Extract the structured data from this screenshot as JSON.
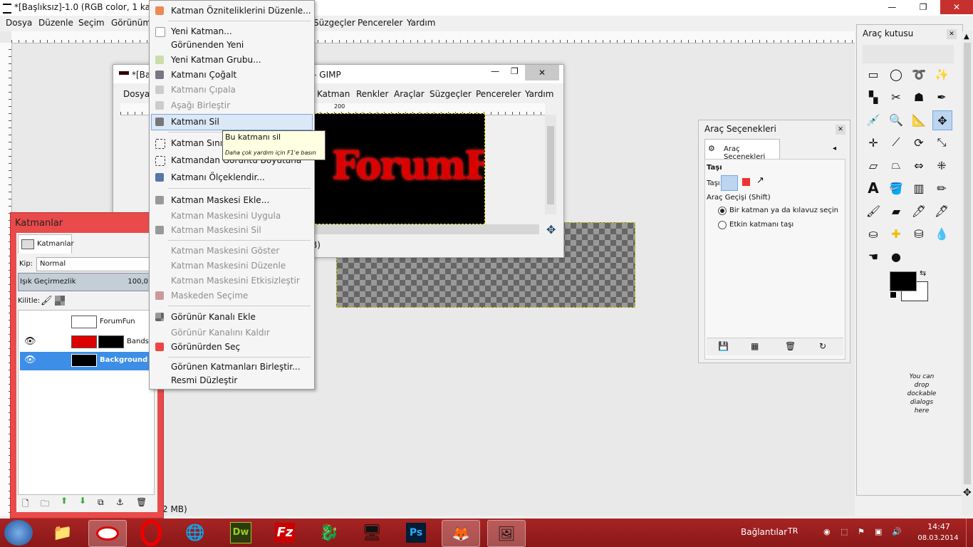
{
  "window": {
    "title": "*[Başlıksız]-1.0 (RGB color, 1 katm",
    "controls": {
      "minimize": "—",
      "maximize": "❐",
      "close": "✕"
    }
  },
  "menubar": [
    "Dosya",
    "Düzenle",
    "Seçim",
    "Görünüm",
    "Süzgeçler",
    "Pencereler",
    "Yardım"
  ],
  "win2": {
    "title_left": "*[Ba",
    "title_right": "5 – GIMP",
    "menu": [
      "Dosya",
      "Katman",
      "Renkler",
      "Araçlar",
      "Süzgeçler",
      "Pencereler",
      "Yardım"
    ],
    "ruler_mark": "200",
    "status": "B)"
  },
  "status_main": "2 MB)",
  "context_menu": {
    "items": [
      {
        "label": "Katman Özniteliklerini Düzenle...",
        "enabled": true
      },
      {
        "label": "Yeni Katman...",
        "enabled": true
      },
      {
        "label": "Görünenden Yeni",
        "enabled": true
      },
      {
        "label": "Yeni Katman Grubu...",
        "enabled": true
      },
      {
        "label": "Katmanı Çoğalt",
        "enabled": true
      },
      {
        "label": "Katmanı Çıpala",
        "enabled": false
      },
      {
        "label": "Aşağı Birleştir",
        "enabled": false
      },
      {
        "label": "Katmanı Sil",
        "enabled": true,
        "highlighted": true
      },
      {
        "label": "Katman Sınır B",
        "enabled": true
      },
      {
        "label": "Katmandan Görüntü Boyutuna",
        "enabled": true
      },
      {
        "label": "Katmanı Ölçeklendir...",
        "enabled": true
      },
      {
        "label": "Katman Maskesi Ekle...",
        "enabled": true
      },
      {
        "label": "Katman Maskesini Uygula",
        "enabled": false
      },
      {
        "label": "Katman Maskesini Sil",
        "enabled": false
      },
      {
        "label": "Katman Maskesini Göster",
        "enabled": false
      },
      {
        "label": "Katman Maskesini Düzenle",
        "enabled": false
      },
      {
        "label": "Katman Maskesini Etkisizleştir",
        "enabled": false
      },
      {
        "label": "Maskeden Seçime",
        "enabled": false
      },
      {
        "label": "Görünür Kanalı Ekle",
        "enabled": true
      },
      {
        "label": "Görünür Kanalını Kaldır",
        "enabled": false
      },
      {
        "label": "Görünürden Seç",
        "enabled": true
      },
      {
        "label": "Görünen Katmanları Birleştir...",
        "enabled": true
      },
      {
        "label": "Resmi Düzleştir",
        "enabled": true
      }
    ]
  },
  "tooltip": {
    "title": "Bu katmanı sil",
    "hint": "Daha çok yardım için F1'e basın"
  },
  "layers": {
    "title": "Katmanlar",
    "tab": "Katmanlar",
    "mode_label": "Kip:",
    "mode_value": "Normal",
    "opacity_label": "Işık Geçirmezlik",
    "opacity_value": "100,0",
    "lock_label": "Kilitle:",
    "rows": [
      {
        "name": "ForumFun",
        "visible": false,
        "selected": false
      },
      {
        "name": "Bands",
        "visible": true,
        "selected": false
      },
      {
        "name": "Background",
        "visible": true,
        "selected": true
      }
    ]
  },
  "tool_options": {
    "title": "Araç Seçenekleri",
    "tab": "Araç Seçenekleri",
    "section": "Taşı",
    "move_label": "Taşı:",
    "toggle_label": "Araç Geçişi  (Shift)",
    "radio1": "Bir katman ya da kılavuz seçin",
    "radio2": "Etkin katmanı taşı"
  },
  "toolbox": {
    "title": "Araç kutusu",
    "drop_hint": "You can drop dockable dialogs here"
  },
  "canvas_text": "ForumFun",
  "taskbar": {
    "connections": "Bağlantılar",
    "lang": "TR",
    "time": "14:47",
    "date": "08.03.2014"
  }
}
